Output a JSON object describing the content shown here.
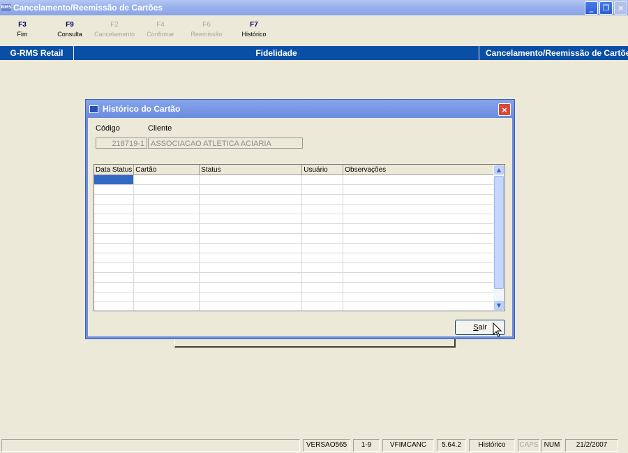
{
  "window": {
    "icon_text": "RMS",
    "title": "Cancelamento/Reemissão de Cartões",
    "buttons": {
      "minimize": "_",
      "maximize": "❐",
      "close": "×"
    }
  },
  "toolbar": {
    "keys": [
      {
        "key": "F3",
        "label": "Fim",
        "enabled": true
      },
      {
        "key": "F9",
        "label": "Consulta",
        "enabled": true
      },
      {
        "key": "F2",
        "label": "Cancelamento",
        "enabled": false
      },
      {
        "key": "F4",
        "label": "Confirmar",
        "enabled": false
      },
      {
        "key": "F6",
        "label": "Reemissão",
        "enabled": false
      },
      {
        "key": "F7",
        "label": "Histórico",
        "enabled": true
      }
    ]
  },
  "header_band": {
    "left": "G-RMS Retail",
    "center": "Fidelidade",
    "right": "Cancelamento/Reemissão de Cartões"
  },
  "dialog": {
    "title": "Histórico do Cartão",
    "close": "×",
    "codigo_label": "Código",
    "cliente_label": "Cliente",
    "codigo_value": "218719-1",
    "cliente_value": "ASSOCIACAO ATLETICA ACIARIA",
    "grid": {
      "columns": [
        "Data Status",
        "Cartão",
        "Status",
        "Usuário",
        "Observações"
      ],
      "row_count": 14,
      "selected_row": 0
    },
    "sair_label": "Sair",
    "sair_accel": "S",
    "sair_rest": "air"
  },
  "statusbar": {
    "cells": [
      "",
      "VERSAO565",
      "1-9",
      "VFIMCANC",
      "5.64.2",
      "Histórico",
      "CAPS",
      "NUM",
      "21/2/2007"
    ]
  },
  "colors": {
    "band": "#0a4fa6",
    "titlebar": "#98b0ec",
    "selection": "#316ac5",
    "disabled_text": "#aca899"
  }
}
